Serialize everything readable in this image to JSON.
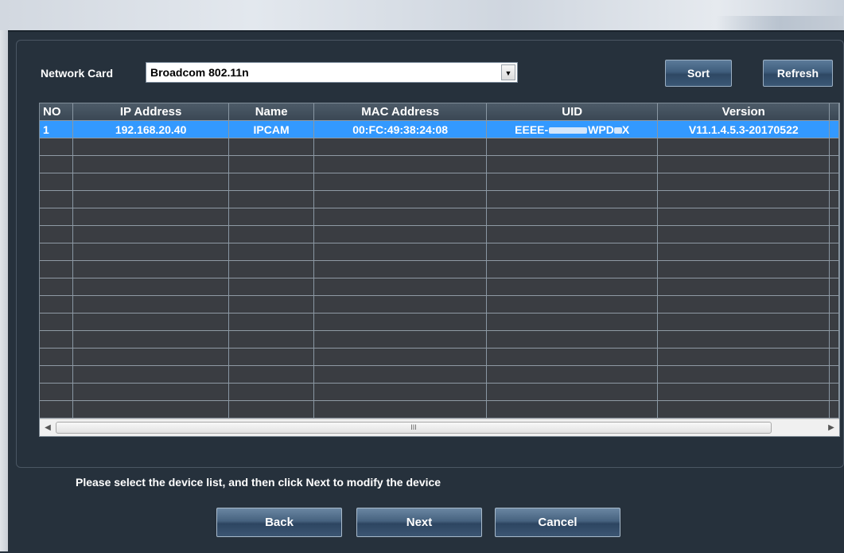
{
  "network_card": {
    "label": "Network Card",
    "selected": "Broadcom 802.11n"
  },
  "buttons": {
    "sort": "Sort",
    "refresh": "Refresh",
    "back": "Back",
    "next": "Next",
    "cancel": "Cancel"
  },
  "table": {
    "columns": [
      "NO",
      "IP Address",
      "Name",
      "MAC Address",
      "UID",
      "Version"
    ],
    "rows": [
      {
        "no": "1",
        "ip": "192.168.20.40",
        "name": "IPCAM",
        "mac": "00:FC:49:38:24:08",
        "uid_prefix": "EEEE-",
        "uid_mid": "WPD",
        "uid_suffix": "X",
        "version": "V11.1.4.5.3-20170522"
      }
    ],
    "empty_row_count": 16
  },
  "scrollbar": {
    "grip": "III"
  },
  "instructions": "Please select the device list, and then click Next to modify the device",
  "colors": {
    "panel_bg": "#26313c",
    "selection": "#3399ff",
    "button_top": "#5b7a99",
    "button_bottom": "#2e4864"
  }
}
